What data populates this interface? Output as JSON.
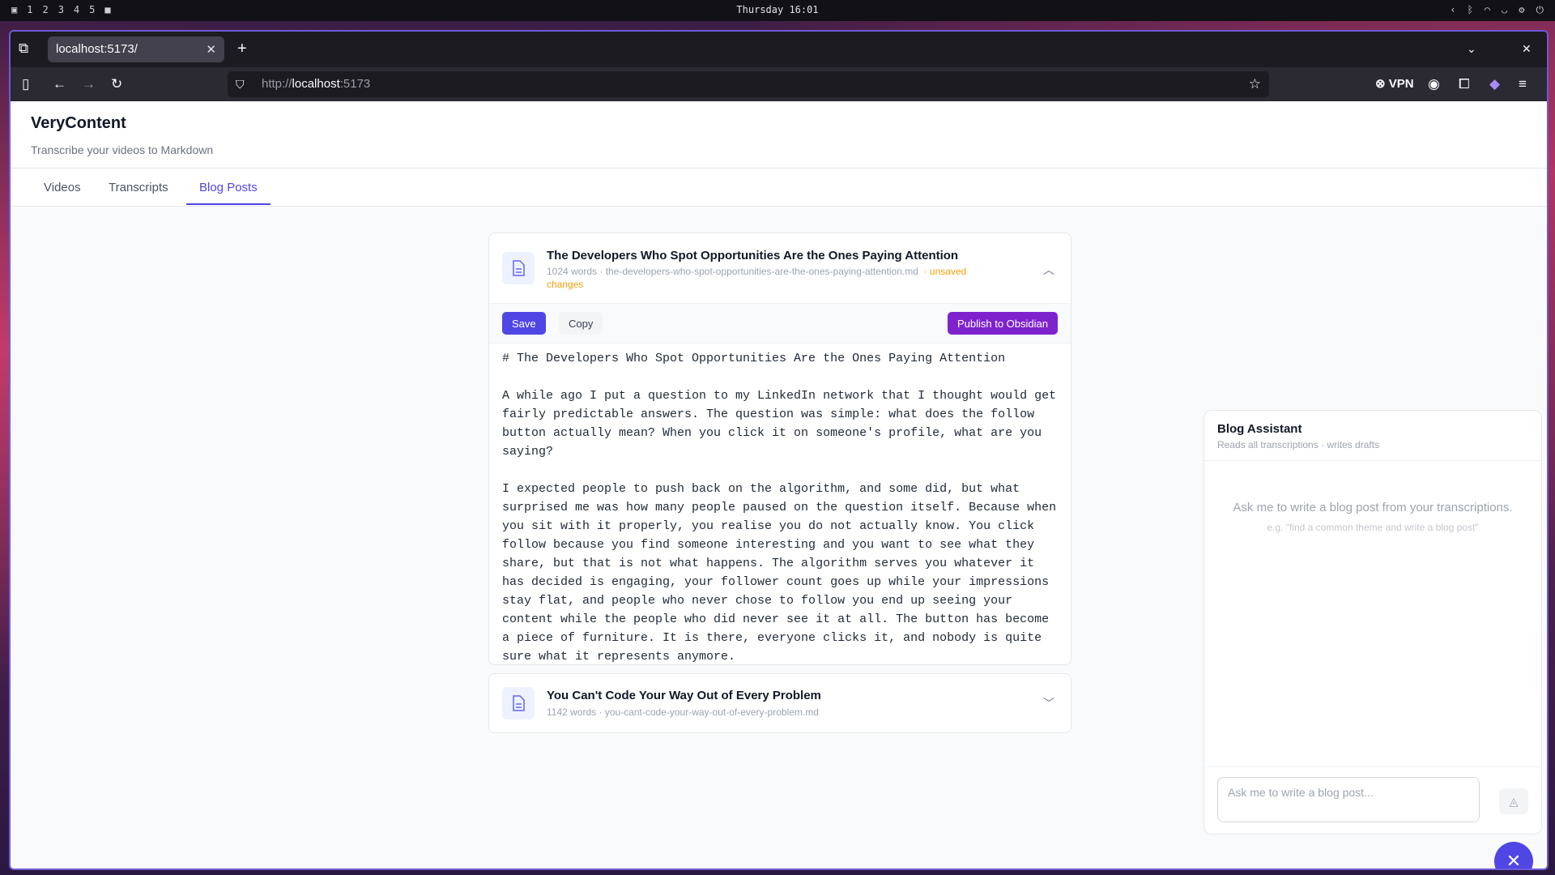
{
  "system_bar": {
    "workspaces": [
      "1",
      "2",
      "3",
      "4",
      "5"
    ],
    "clock": "Thursday 16:01"
  },
  "browser": {
    "tab_title": "localhost:5173/",
    "url_scheme": "http://",
    "url_host": "localhost",
    "url_rest": ":5173",
    "vpn_label": "VPN"
  },
  "app": {
    "title": "VeryContent",
    "subtitle": "Transcribe your videos to Markdown",
    "tabs": [
      {
        "label": "Videos"
      },
      {
        "label": "Transcripts"
      },
      {
        "label": "Blog Posts"
      }
    ],
    "active_tab": "Blog Posts"
  },
  "posts": [
    {
      "title": "The Developers Who Spot Opportunities Are the Ones Paying Attention",
      "meta": "1024 words · the-developers-who-spot-opportunities-are-the-ones-paying-attention.md",
      "status": "· unsaved changes",
      "expanded": true,
      "save_label": "Save",
      "copy_label": "Copy",
      "publish_label": "Publish to Obsidian",
      "content": "# The Developers Who Spot Opportunities Are the Ones Paying Attention\n\nA while ago I put a question to my LinkedIn network that I thought would get fairly predictable answers. The question was simple: what does the follow button actually mean? When you click it on someone's profile, what are you saying?\n\nI expected people to push back on the algorithm, and some did, but what surprised me was how many people paused on the question itself. Because when you sit with it properly, you realise you do not actually know. You click follow because you find someone interesting and you want to see what they share, but that is not what happens. The algorithm serves you whatever it has decided is engaging, your follower count goes up while your impressions stay flat, and people who never chose to follow you end up seeing your content while the people who did never see it at all. The button has become a piece of furniture. It is there, everyone clicks it, and nobody is quite sure what it represents anymore.\n\nThat is not a small thing. That is a sign that something has broken at a"
    },
    {
      "title": "You Can't Code Your Way Out of Every Problem",
      "meta": "1142 words · you-cant-code-your-way-out-of-every-problem.md",
      "expanded": false
    }
  ],
  "assistant": {
    "title": "Blog Assistant",
    "subtitle": "Reads all transcriptions · writes drafts",
    "empty_hint": "Ask me to write a blog post from your transcriptions.",
    "empty_example": "e.g. \"find a common theme and write a blog post\"",
    "input_placeholder": "Ask me to write a blog post..."
  },
  "colors": {
    "accent": "#4f46e5",
    "publish": "#7e22ce",
    "warning": "#f59e0b"
  }
}
